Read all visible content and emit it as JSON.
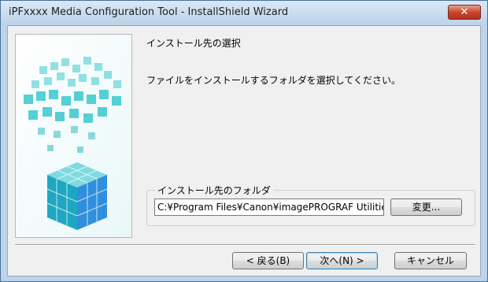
{
  "window": {
    "title": "iPFxxxx Media Configuration Tool - InstallShield Wizard",
    "close_glyph": "✕"
  },
  "page": {
    "heading": "インストール先の選択",
    "description": "ファイルをインストールするフォルダを選択してください。"
  },
  "destination": {
    "group_label": "インストール先のフォルダ",
    "path": "C:¥Program Files¥Canon¥imagePROGRAF Utilitie",
    "change_label": "変更..."
  },
  "buttons": {
    "back": "< 戻る(B)",
    "next": "次へ(N) >",
    "cancel": "キャンセル"
  },
  "colors": {
    "accent": "#1fc2c9",
    "cube_blue": "#2f8fdc"
  }
}
